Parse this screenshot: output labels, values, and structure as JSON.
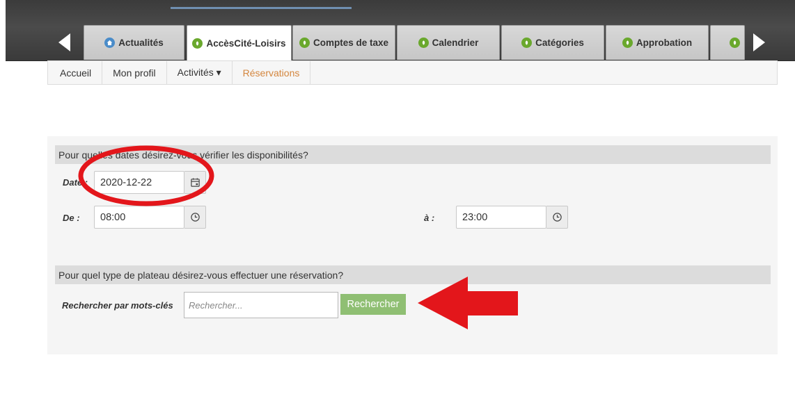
{
  "tabs": [
    {
      "label": "Actualités",
      "icon": "home-icon",
      "color": "#4a8cc9",
      "active": false
    },
    {
      "label": "AccèsCité-Loisirs",
      "icon": "leaf-icon",
      "color": "#6aa82d",
      "active": true
    },
    {
      "label": "Comptes de taxe",
      "icon": "leaf-icon",
      "color": "#6aa82d",
      "active": false
    },
    {
      "label": "Calendrier",
      "icon": "leaf-icon",
      "color": "#6aa82d",
      "active": false
    },
    {
      "label": "Catégories",
      "icon": "leaf-icon",
      "color": "#6aa82d",
      "active": false
    },
    {
      "label": "Approbation",
      "icon": "leaf-icon",
      "color": "#6aa82d",
      "active": false
    },
    {
      "label": "",
      "icon": "leaf-icon",
      "color": "#6aa82d",
      "active": false
    }
  ],
  "subnav": {
    "items": [
      {
        "label": "Accueil"
      },
      {
        "label": "Mon profil"
      },
      {
        "label": "Activités ▾"
      },
      {
        "label": "Réservations",
        "active": true
      }
    ],
    "active_color": "#d4863e"
  },
  "availability": {
    "heading": "Pour quelles dates désirez-vous vérifier les disponibilités?",
    "date_label": "Date :",
    "date_value": "2020-12-22",
    "from_label": "De :",
    "from_value": "08:00",
    "to_label": "à :",
    "to_value": "23:00"
  },
  "plateau": {
    "heading": "Pour quel type de plateau désirez-vous effectuer une réservation?",
    "keywords_label": "Rechercher par mots-clés",
    "search_placeholder": "Rechercher...",
    "search_button": "Rechercher",
    "button_color": "#8fbf73"
  },
  "annotations": {
    "circle_color": "#e3161b",
    "arrow_color": "#e3161b"
  }
}
